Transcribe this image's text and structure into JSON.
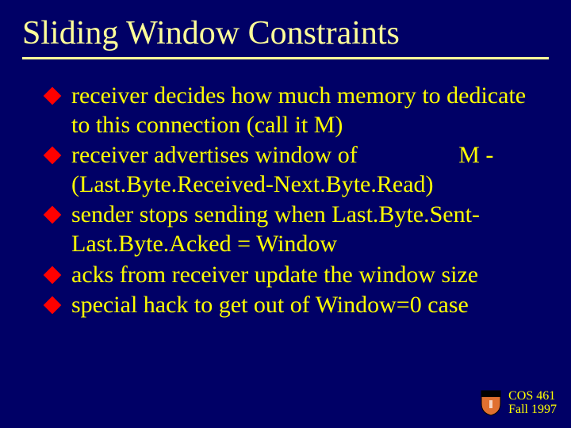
{
  "title": "Sliding Window Constraints",
  "bullets": [
    "receiver decides how much memory to dedicate to this connection (call it M)",
    "receiver advertises window of                 M -(Last.Byte.Received-Next.Byte.Read)",
    "sender stops sending when Last.Byte.Sent-Last.Byte.Acked = Window",
    "acks from receiver update the window size",
    "special hack to get out of Window=0 case"
  ],
  "footer": {
    "course": "COS 461",
    "term": "Fall 1997"
  }
}
